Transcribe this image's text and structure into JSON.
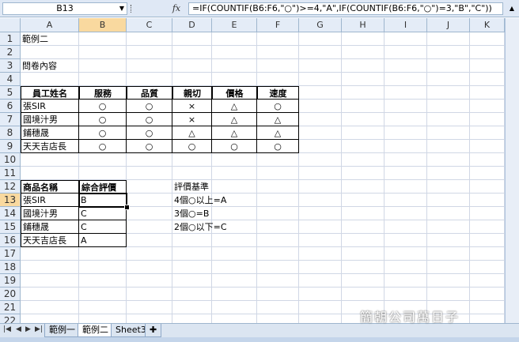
{
  "formula_bar": {
    "name_box": "B13",
    "fx_label": "fx",
    "formula": "=IF(COUNTIF(B6:F6,\"○\")>=4,\"A\",IF(COUNTIF(B6:F6,\"○\")=3,\"B\",\"C\"))"
  },
  "columns": [
    "A",
    "B",
    "C",
    "D",
    "E",
    "F",
    "G",
    "H",
    "I",
    "J",
    "K"
  ],
  "rows": [
    "1",
    "2",
    "3",
    "4",
    "5",
    "6",
    "7",
    "8",
    "9",
    "10",
    "11",
    "12",
    "13",
    "14",
    "15",
    "16",
    "17",
    "18",
    "19",
    "20",
    "21",
    "22"
  ],
  "cells": {
    "A1": "範例二",
    "A3": "問卷內容",
    "survey_headers": [
      "員工姓名",
      "服務",
      "品質",
      "親切",
      "價格",
      "速度"
    ],
    "survey_rows": [
      {
        "name": "張SIR",
        "marks": [
          "○",
          "○",
          "×",
          "△",
          "○"
        ]
      },
      {
        "name": "國境汁男",
        "marks": [
          "○",
          "○",
          "×",
          "△",
          "△"
        ]
      },
      {
        "name": "鋪穗晟",
        "marks": [
          "○",
          "○",
          "△",
          "△",
          "△"
        ]
      },
      {
        "name": "天天吉店長",
        "marks": [
          "○",
          "○",
          "○",
          "○",
          "○"
        ]
      }
    ],
    "result_headers": [
      "商品名稱",
      "綜合評價"
    ],
    "result_rows": [
      {
        "name": "張SIR",
        "grade": "B"
      },
      {
        "name": "國境汁男",
        "grade": "C"
      },
      {
        "name": "鋪穗晟",
        "grade": "C"
      },
      {
        "name": "天天吉店長",
        "grade": "A"
      }
    ],
    "criteria_title": "評價基準",
    "criteria": [
      "4個○以上=A",
      "3個○=B",
      "2個○以下=C"
    ]
  },
  "sheet_tabs": [
    "範例一",
    "範例二",
    "Sheet3"
  ],
  "active_tab": "範例二",
  "watermark": "簡朝公司萬日子"
}
